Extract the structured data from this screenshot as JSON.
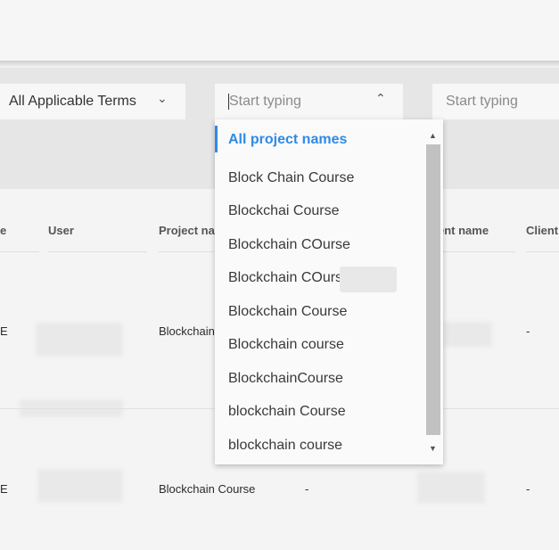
{
  "filters": {
    "terms": {
      "value": "All Applicable Terms",
      "caret": "⌄"
    },
    "project": {
      "placeholder": "Start typing",
      "caret": "⌃"
    },
    "client": {
      "placeholder": "Start typing"
    }
  },
  "table": {
    "headers": [
      "e",
      "User",
      "Project na",
      "ent name",
      "Client"
    ],
    "rows": [
      {
        "col0": "E",
        "project": "Blockchain",
        "client": "-"
      },
      {
        "col0": "E",
        "project": "Blockchain Course",
        "col3": "-",
        "client": "-"
      }
    ]
  },
  "dropdown": {
    "header": "All project names",
    "options": [
      "Block Chain Course",
      "Blockchai Course",
      "Blockchain COurse",
      "Blockchain COurse",
      "Blockchain Course",
      "Blockchain course",
      "BlockchainCourse",
      "blockchain Course",
      "blockchain course"
    ],
    "scroll_up": "▲",
    "scroll_down": "▼"
  },
  "colors": {
    "accent": "#2e8ae6"
  }
}
